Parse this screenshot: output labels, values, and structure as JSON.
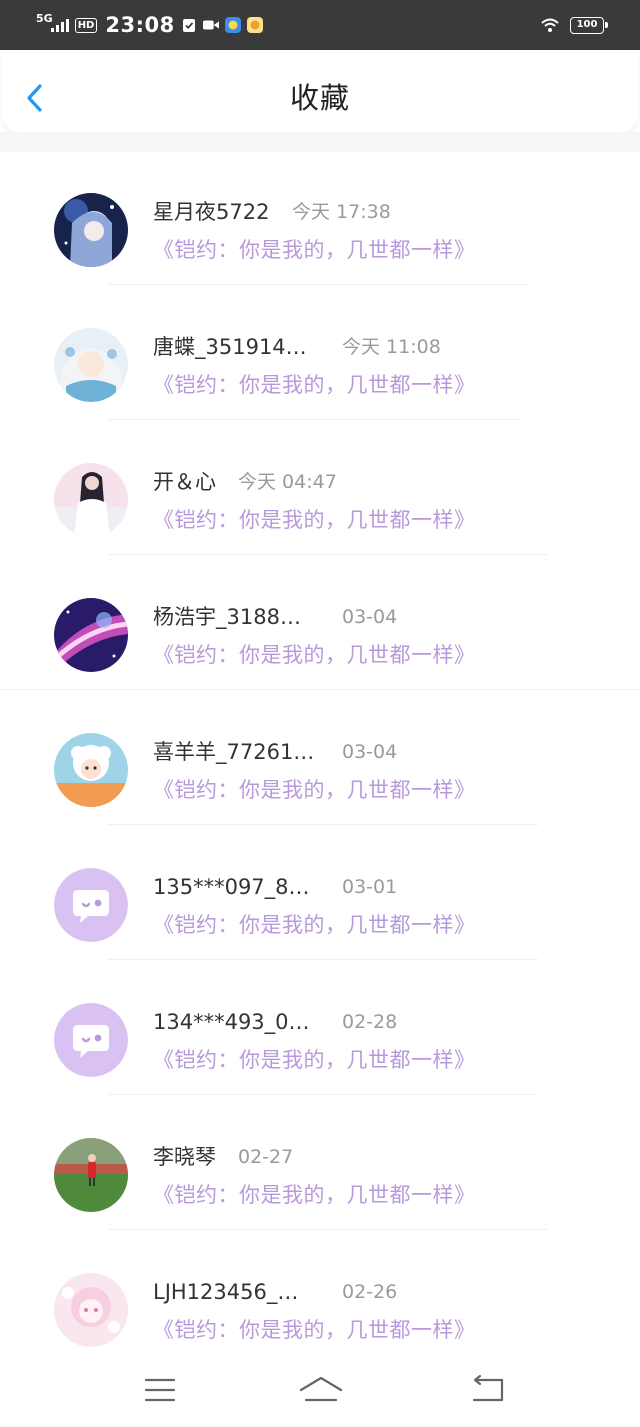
{
  "status_bar": {
    "network": "5G",
    "hd": "HD",
    "time": "23:08",
    "battery": "100",
    "icons": [
      "signal-icon",
      "task-icon",
      "video-icon",
      "app-icon-blue",
      "app-icon-yellow",
      "wifi-icon",
      "battery-icon"
    ]
  },
  "header": {
    "title": "收藏",
    "back_icon": "chevron-left-icon",
    "accent": "#2196f3"
  },
  "items": [
    {
      "name": "星月夜5722",
      "time": "今天 17:38",
      "message": "《铠约：你是我的，几世都一样》"
    },
    {
      "name": "唐蝶_351914…",
      "time": "今天 11:08",
      "message": "《铠约：你是我的，几世都一样》"
    },
    {
      "name": "开＆心",
      "time": "今天 04:47",
      "message": "《铠约：你是我的，几世都一样》"
    },
    {
      "name": "杨浩宇_3188…",
      "time": "03-04",
      "message": "《铠约：你是我的，几世都一样》"
    },
    {
      "name": "喜羊羊_77261…",
      "time": "03-04",
      "message": "《铠约：你是我的，几世都一样》"
    },
    {
      "name": "135***097_8…",
      "time": "03-01",
      "message": "《铠约：你是我的，几世都一样》"
    },
    {
      "name": "134***493_0…",
      "time": "02-28",
      "message": "《铠约：你是我的，几世都一样》"
    },
    {
      "name": "李晓琴",
      "time": "02-27",
      "message": "《铠约：你是我的，几世都一样》"
    },
    {
      "name": "LJH123456_…",
      "time": "02-26",
      "message": "《铠约：你是我的，几世都一样》"
    }
  ],
  "colors": {
    "message": "#b899db",
    "name": "#333333",
    "time": "#9a9a9a",
    "default_avatar": "#d9c2f2"
  },
  "bottom_nav": {
    "icons": [
      "menu-icon",
      "home-icon",
      "back-icon"
    ]
  }
}
